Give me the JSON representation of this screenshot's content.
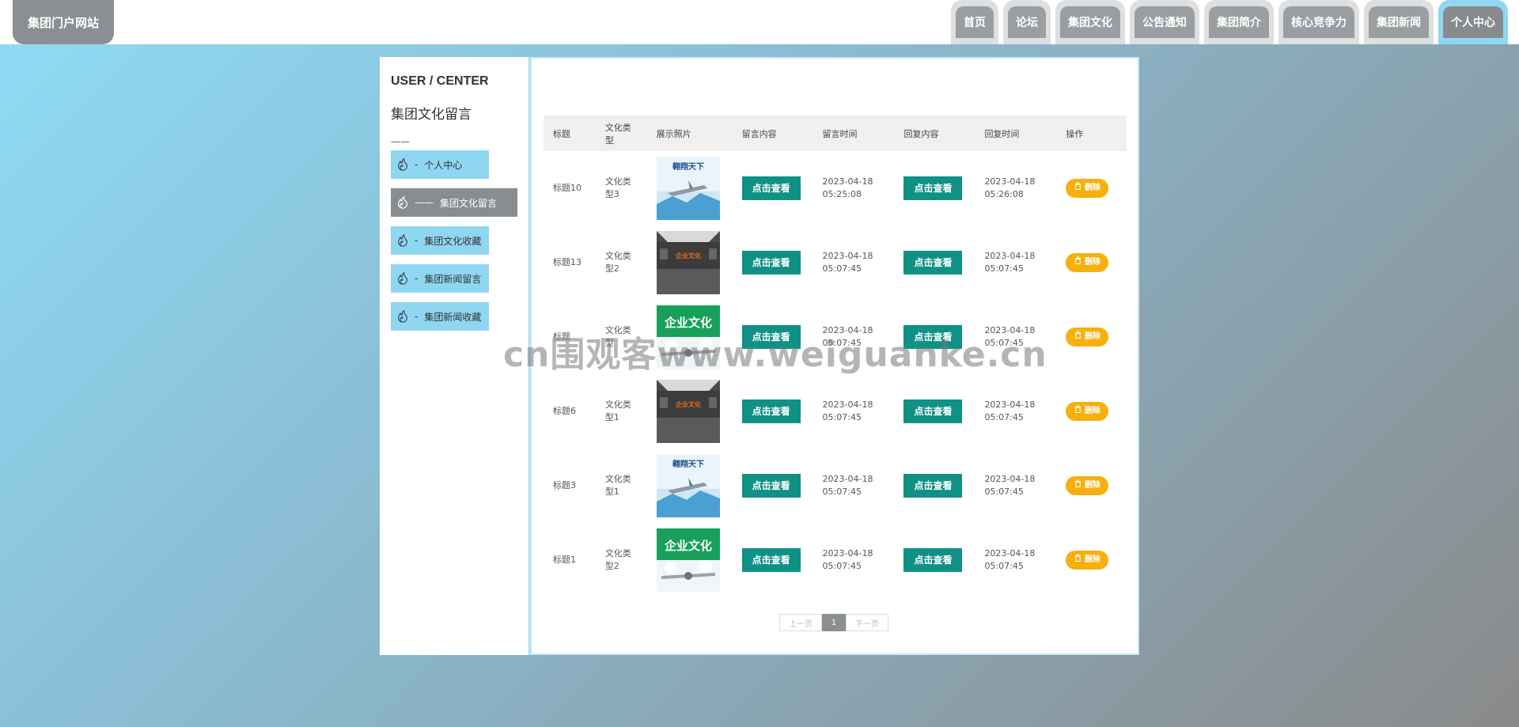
{
  "site": {
    "logo": "集团门户网站"
  },
  "nav": {
    "items": [
      "首页",
      "论坛",
      "集团文化",
      "公告通知",
      "集团简介",
      "核心竞争力",
      "集团新闻",
      "个人中心"
    ],
    "active": "个人中心"
  },
  "sidebar": {
    "title_en": "USER / CENTER",
    "title_cn": "集团文化留言",
    "divider": "——",
    "items": [
      {
        "label": "个人中心",
        "dash": "-"
      },
      {
        "label": "集团文化留言",
        "dash": "——"
      },
      {
        "label": "集团文化收藏",
        "dash": "-"
      },
      {
        "label": "集团新闻留言",
        "dash": "-"
      },
      {
        "label": "集团新闻收藏",
        "dash": "-"
      }
    ]
  },
  "table": {
    "headers": [
      "标题",
      "文化类型",
      "展示照片",
      "留言内容",
      "留言时间",
      "回复内容",
      "回复时间",
      "操作"
    ],
    "view_label": "点击查看",
    "delete_label": "删除",
    "rows": [
      {
        "title": "标题10",
        "type": "文化类型3",
        "photo": "banner-sky",
        "msg_time": "2023-04-18 05:25:08",
        "reply_time": "2023-04-18 05:26:08"
      },
      {
        "title": "标题13",
        "type": "文化类型2",
        "photo": "culture-wall",
        "msg_time": "2023-04-18 05:07:45",
        "reply_time": "2023-04-18 05:07:45"
      },
      {
        "title": "标题",
        "type": "文化类型",
        "photo": "green-culture",
        "msg_time": "2023-04-18 05:07:45",
        "reply_time": "2023-04-18 05:07:45"
      },
      {
        "title": "标题6",
        "type": "文化类型1",
        "photo": "culture-wall",
        "msg_time": "2023-04-18 05:07:45",
        "reply_time": "2023-04-18 05:07:45"
      },
      {
        "title": "标题3",
        "type": "文化类型1",
        "photo": "banner-sky",
        "msg_time": "2023-04-18 05:07:45",
        "reply_time": "2023-04-18 05:07:45"
      },
      {
        "title": "标题1",
        "type": "文化类型2",
        "photo": "green-culture",
        "msg_time": "2023-04-18 05:07:45",
        "reply_time": "2023-04-18 05:07:45"
      }
    ]
  },
  "pager": {
    "prev": "上一页",
    "current": "1",
    "next": "下一页"
  },
  "photo_texts": {
    "banner_sky": "翱翔天下",
    "culture_wall": "企业文化",
    "green_culture": "企业文化"
  },
  "watermark": "cn围观客www.weiguanke.cn",
  "colors": {
    "accent_teal": "#109185",
    "delete_yellow": "#f6b00d",
    "menu_blue": "#8fd6f1",
    "menu_active": "#878d91"
  }
}
